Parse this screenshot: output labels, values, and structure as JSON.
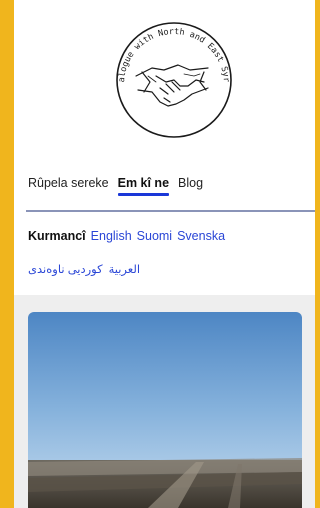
{
  "logo": {
    "text": "Dialogue with North and East Syria"
  },
  "nav": {
    "items": [
      {
        "label": "Rûpela sereke"
      },
      {
        "label": "Em kî ne"
      },
      {
        "label": "Blog"
      }
    ]
  },
  "languages": {
    "current": "Kurmancî",
    "options": [
      "English",
      "Suomi",
      "Svenska"
    ],
    "rtl_options": [
      "العربية",
      "کوردیی ناوەندی"
    ]
  },
  "colors": {
    "frame": "#f0b51d",
    "link": "#2a46d6",
    "active_underline": "#1a37d8"
  },
  "hero": {
    "image": "photo-landscape"
  }
}
